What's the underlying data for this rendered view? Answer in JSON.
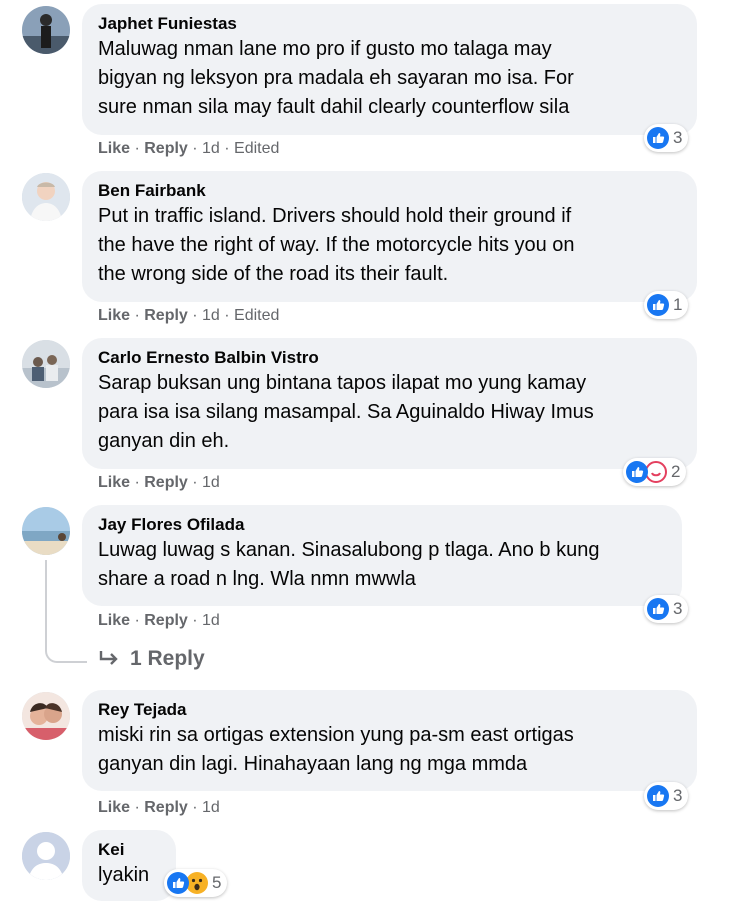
{
  "comments": [
    {
      "author": "Japhet Funiestas",
      "lines": [
        "Maluwag nman lane mo pro if gusto mo talaga may",
        "bigyan ng leksyon pra madala eh sayaran mo isa. For",
        "sure nman sila may fault dahil clearly counterflow sila"
      ],
      "like": "Like",
      "reply": "Reply",
      "time": "1d",
      "edited": "Edited",
      "reaction_count": "3",
      "reactions": [
        "like-icon"
      ]
    },
    {
      "author": "Ben Fairbank",
      "lines": [
        "Put in traffic island. Drivers should hold their ground if",
        "the have the right of way. If the motorcycle hits you on",
        "the wrong side of the road its their fault."
      ],
      "like": "Like",
      "reply": "Reply",
      "time": "1d",
      "edited": "Edited",
      "reaction_count": "1",
      "reactions": [
        "like-icon"
      ]
    },
    {
      "author": "Carlo Ernesto Balbin Vistro",
      "lines": [
        "Sarap buksan ung bintana tapos ilapat mo yung kamay",
        "para isa isa silang masampal. Sa Aguinaldo Hiway Imus",
        "ganyan din eh."
      ],
      "like": "Like",
      "reply": "Reply",
      "time": "1d",
      "reaction_count": "2",
      "reactions": [
        "like-icon",
        "haha-icon"
      ]
    },
    {
      "author": "Jay Flores Ofilada",
      "lines": [
        "Luwag luwag s kanan. Sinasalubong p tlaga. Ano b kung",
        "share a road n lng. Wla nmn mwwla"
      ],
      "like": "Like",
      "reply": "Reply",
      "time": "1d",
      "reaction_count": "3",
      "reactions": [
        "like-icon"
      ],
      "replies_label": "1 Reply"
    },
    {
      "author": "Rey Tejada",
      "lines": [
        "miski rin sa ortigas extension yung pa-sm east ortigas",
        "ganyan din lagi. Hinahayaan lang ng mga mmda"
      ],
      "like": "Like",
      "reply": "Reply",
      "time": "1d",
      "reaction_count": "3",
      "reactions": [
        "like-icon"
      ]
    },
    {
      "author": "Kei",
      "lines": [
        "lyakin"
      ],
      "reaction_count": "5",
      "reactions": [
        "like-icon",
        "wow-icon"
      ]
    }
  ],
  "colors": {
    "like_blue": "#1877f2",
    "haha_red": "#e4405f",
    "wow_yellow": "#f7b125",
    "bubble": "#f0f2f5",
    "meta": "#65676b"
  }
}
